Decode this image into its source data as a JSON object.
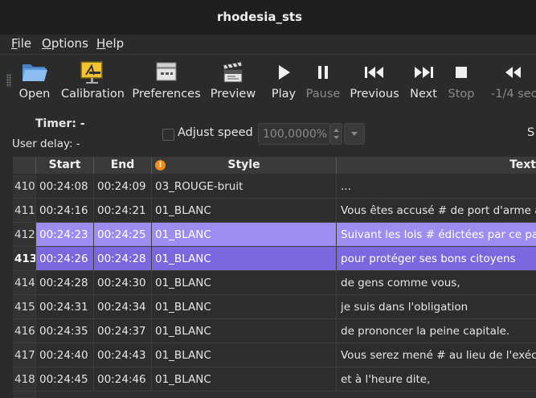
{
  "window": {
    "title": "rhodesia_sts"
  },
  "menu": [
    {
      "label": "File",
      "u": "F",
      "rest": "ile"
    },
    {
      "label": "Options",
      "u": "O",
      "rest": "ptions"
    },
    {
      "label": "Help",
      "u": "H",
      "rest": "elp"
    }
  ],
  "toolbar": {
    "open": "Open",
    "calibration": "Calibration",
    "preferences": "Preferences",
    "preview": "Preview",
    "play": "Play",
    "pause": "Pause",
    "previous": "Previous",
    "next": "Next",
    "stop": "Stop",
    "back_quarter": "-1/4 sec"
  },
  "controls": {
    "timer_label": "Timer: -",
    "user_delay": "User delay: -",
    "adjust_speed": "Adjust speed",
    "speed_value": "100,0000%",
    "clipped_right_label": "S"
  },
  "table": {
    "headers": [
      "Start",
      "End",
      "Style",
      "Text"
    ],
    "rows": [
      {
        "num": "410",
        "start": "00:24:08",
        "end": "00:24:09",
        "style": "03_ROUGE-bruit",
        "text": "..."
      },
      {
        "num": "411",
        "start": "00:24:16",
        "end": "00:24:21",
        "style": "01_BLANC",
        "text": "Vous êtes accusé # de port d'arme à"
      },
      {
        "num": "412",
        "start": "00:24:23",
        "end": "00:24:25",
        "style": "01_BLANC",
        "text": "Suivant les lois # édictées par ce pay"
      },
      {
        "num": "413",
        "start": "00:24:26",
        "end": "00:24:28",
        "style": "01_BLANC",
        "text": "pour protéger ses bons citoyens"
      },
      {
        "num": "414",
        "start": "00:24:28",
        "end": "00:24:30",
        "style": "01_BLANC",
        "text": "de gens comme vous,"
      },
      {
        "num": "415",
        "start": "00:24:31",
        "end": "00:24:34",
        "style": "01_BLANC",
        "text": "je suis dans l'obligation"
      },
      {
        "num": "416",
        "start": "00:24:35",
        "end": "00:24:37",
        "style": "01_BLANC",
        "text": "de prononcer la peine capitale."
      },
      {
        "num": "417",
        "start": "00:24:40",
        "end": "00:24:43",
        "style": "01_BLANC",
        "text": "Vous serez mené # au lieu de l'exécu"
      },
      {
        "num": "418",
        "start": "00:24:45",
        "end": "00:24:46",
        "style": "01_BLANC",
        "text": "et à l'heure dite,"
      }
    ]
  }
}
